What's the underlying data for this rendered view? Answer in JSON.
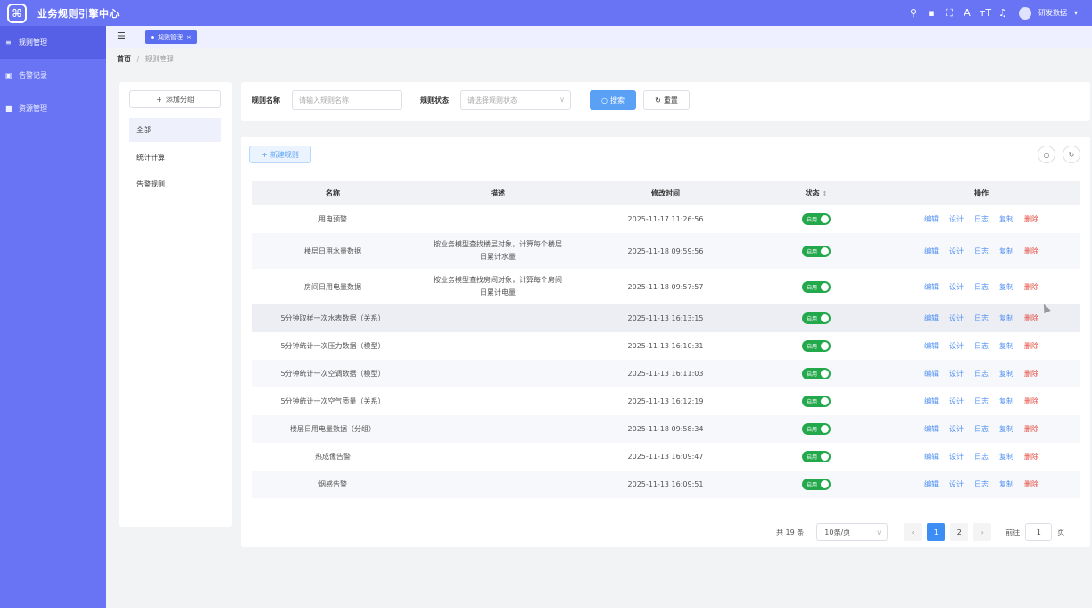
{
  "app": {
    "logo": "⌘",
    "title": "业务规则引擎中心"
  },
  "topbar": {
    "icons": [
      "search-icon",
      "chat-icon",
      "fullscreen-icon",
      "translate-icon",
      "font-size-icon",
      "bell-icon"
    ],
    "glyphs": [
      "⚲",
      "▪",
      "⛶",
      "A",
      "тT",
      "♫"
    ],
    "user_name": "研发数据",
    "user_caret": "▾"
  },
  "sidebar": {
    "items": [
      {
        "label": "规则管理",
        "glyph": "≡",
        "icon": "list-icon"
      },
      {
        "label": "告警记录",
        "glyph": "▣",
        "icon": "alarm-record-icon"
      },
      {
        "label": "资源管理",
        "glyph": "■",
        "icon": "resource-icon"
      }
    ]
  },
  "header": {
    "menu_toggle": "☰",
    "tab_label": "规则管理",
    "tab_close": "×"
  },
  "breadcrumb": {
    "home": "首页",
    "sep": "/",
    "current": "规则管理"
  },
  "groups": {
    "add_label": "添加分组",
    "plus": "+",
    "items": [
      "全部",
      "统计计算",
      "告警规则"
    ]
  },
  "search": {
    "name_label": "规则名称",
    "name_placeholder": "请输入规则名称",
    "status_label": "规则状态",
    "status_placeholder": "请选择规则状态",
    "arrow": "∨",
    "search_btn": "搜索",
    "search_glyph": "○",
    "reset_btn": "重置",
    "reset_glyph": "↻"
  },
  "toolbar": {
    "new_btn": "新建规则",
    "plus": "+",
    "search_glyph": "○",
    "refresh_glyph": "↻"
  },
  "table": {
    "columns": [
      "名称",
      "描述",
      "修改时间",
      "状态",
      "操作"
    ],
    "sort_glyph": "↕",
    "toggle_label": "启用",
    "ops": [
      "编辑",
      "设计",
      "日志",
      "复制",
      "删除"
    ],
    "rows": [
      {
        "name": "用电预警",
        "desc1": "",
        "desc2": "",
        "time": "2025-11-17 11:26:56"
      },
      {
        "name": "楼层日用水量数据",
        "desc1": "按业务模型查找楼层对象，计算每个楼层",
        "desc2": "日累计水量",
        "time": "2025-11-18 09:59:56"
      },
      {
        "name": "房间日用电量数据",
        "desc1": "按业务模型查找房间对象，计算每个房间",
        "desc2": "日累计电量",
        "time": "2025-11-18 09:57:57"
      },
      {
        "name": "5分钟取样一次水表数据（关系）",
        "desc1": "",
        "desc2": "",
        "time": "2025-11-13 16:13:15"
      },
      {
        "name": "5分钟统计一次压力数据（模型）",
        "desc1": "",
        "desc2": "",
        "time": "2025-11-13 16:10:31"
      },
      {
        "name": "5分钟统计一次空调数据（模型）",
        "desc1": "",
        "desc2": "",
        "time": "2025-11-13 16:11:03"
      },
      {
        "name": "5分钟统计一次空气质量（关系）",
        "desc1": "",
        "desc2": "",
        "time": "2025-11-13 16:12:19"
      },
      {
        "name": "楼层日用电量数据（分组）",
        "desc1": "",
        "desc2": "",
        "time": "2025-11-18 09:58:34"
      },
      {
        "name": "热成像告警",
        "desc1": "",
        "desc2": "",
        "time": "2025-11-13 16:09:47"
      },
      {
        "name": "烟感告警",
        "desc1": "",
        "desc2": "",
        "time": "2025-11-13 16:09:51"
      }
    ]
  },
  "pagination": {
    "total": "共 19 条",
    "page_size": "10条/页",
    "size_arrow": "∨",
    "prev": "‹",
    "pages": [
      "1",
      "2"
    ],
    "next": "›",
    "goto_label": "前往",
    "goto_value": "1",
    "goto_suffix": "页"
  },
  "colors": {
    "brand": "#6874f3",
    "primary": "#5aa1f5",
    "success": "#23a84b",
    "danger": "#e4483c",
    "link": "#4c8ef2"
  }
}
